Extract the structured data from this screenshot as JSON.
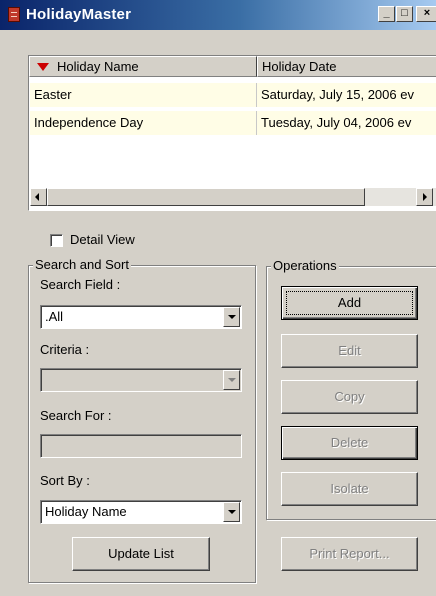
{
  "window": {
    "title": "HolidayMaster",
    "controls": {
      "minimize": "_",
      "maximize": "□",
      "close": "×"
    }
  },
  "listview": {
    "columns": [
      "Holiday Name",
      "Holiday Date"
    ],
    "sort_indicator": "descending",
    "rows": [
      {
        "name": "Easter",
        "date": "Saturday, July 15, 2006 ev"
      },
      {
        "name": "Independence Day",
        "date": "Tuesday, July 04, 2006 ev"
      }
    ]
  },
  "detail_view": {
    "label": "Detail View",
    "checked": false
  },
  "search_sort": {
    "legend": "Search and Sort",
    "search_field_label": "Search Field :",
    "search_field_value": ".All",
    "criteria_label": "Criteria :",
    "criteria_value": "",
    "search_for_label": "Search For :",
    "search_for_value": "",
    "sort_by_label": "Sort By :",
    "sort_by_value": "Holiday Name",
    "update_button": "Update List"
  },
  "operations": {
    "legend": "Operations",
    "buttons": [
      {
        "label": "Add",
        "enabled": true
      },
      {
        "label": "Edit",
        "enabled": false
      },
      {
        "label": "Copy",
        "enabled": false
      },
      {
        "label": "Delete",
        "enabled": false
      },
      {
        "label": "Isolate",
        "enabled": false
      }
    ],
    "print_button": {
      "label": "Print Report...",
      "enabled": false
    }
  },
  "colors": {
    "titlebar_start": "#0a246a",
    "titlebar_end": "#a6caf0",
    "row_highlight": "#fffde6",
    "sort_arrow": "#cc0000"
  }
}
